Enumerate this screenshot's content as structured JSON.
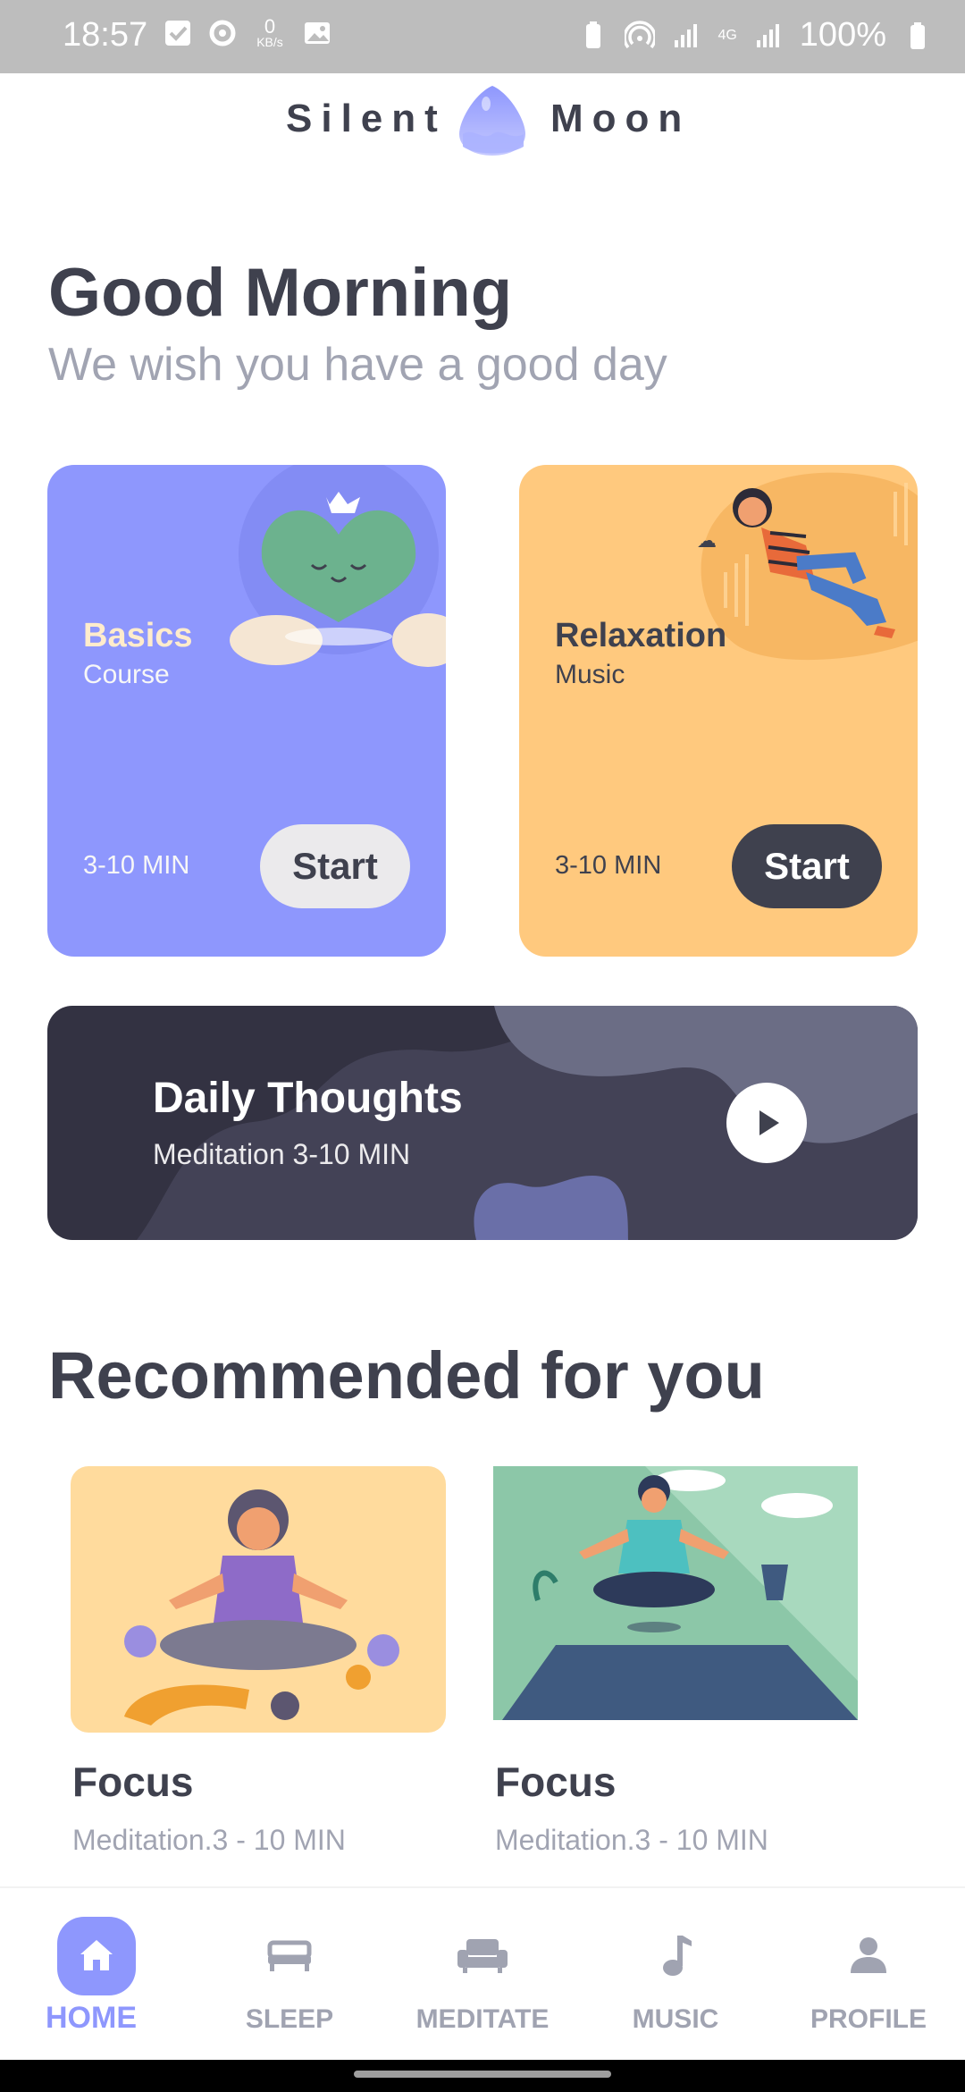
{
  "status_bar": {
    "time": "18:57",
    "speed_value": "0",
    "speed_unit": "KB/s",
    "network": "4G",
    "battery": "100%"
  },
  "header": {
    "brand_left": "Silent",
    "brand_right": "Moon"
  },
  "greeting": {
    "title": "Good Morning",
    "subtitle": "We wish you have a good day"
  },
  "cards": [
    {
      "title": "Basics",
      "type": "Course",
      "duration": "3-10 MIN",
      "button": "Start",
      "color": "#8E97FD"
    },
    {
      "title": "Relaxation",
      "type": "Music",
      "duration": "3-10 MIN",
      "button": "Start",
      "color": "#FFC97E"
    }
  ],
  "daily": {
    "title": "Daily Thoughts",
    "subtitle": "Meditation 3-10 MIN"
  },
  "recommended": {
    "title": "Recommended for you",
    "items": [
      {
        "name": "Focus",
        "meta": "Meditation.3 - 10 MIN"
      },
      {
        "name": "Focus",
        "meta": "Meditation.3 - 10 MIN"
      }
    ]
  },
  "nav": {
    "items": [
      {
        "label": "HOME",
        "icon": "home-icon",
        "active": true
      },
      {
        "label": "SLEEP",
        "icon": "bed-icon",
        "active": false
      },
      {
        "label": "MEDITATE",
        "icon": "sofa-icon",
        "active": false
      },
      {
        "label": "MUSIC",
        "icon": "music-note-icon",
        "active": false
      },
      {
        "label": "PROFILE",
        "icon": "person-icon",
        "active": false
      }
    ]
  },
  "colors": {
    "accent": "#8E97FD",
    "text_dark": "#3F414E",
    "text_muted": "#A1A4B2",
    "orange_card": "#FFC97E",
    "dark_banner": "#333242"
  }
}
